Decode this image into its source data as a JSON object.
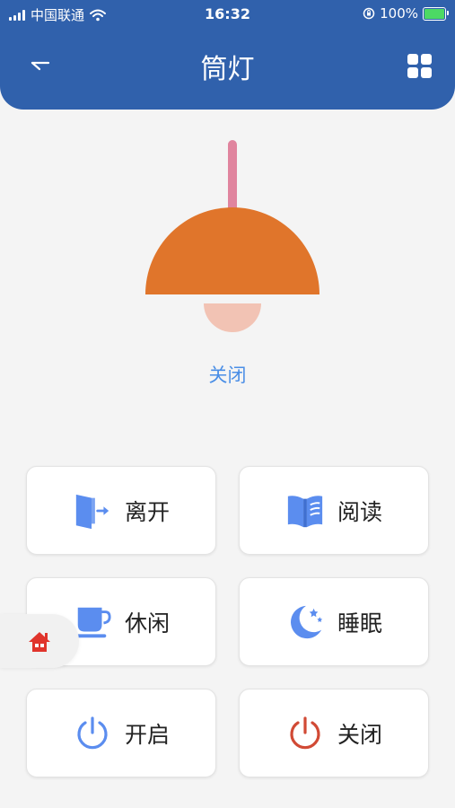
{
  "status_bar": {
    "carrier": "中国联通",
    "time": "16:32",
    "battery_percent": "100%",
    "battery_level": 1.0
  },
  "header": {
    "title": "筒灯",
    "back_icon": "back-arrow-icon",
    "menu_icon": "grid-menu-icon"
  },
  "lamp": {
    "state_label": "关闭",
    "shade_color": "#e0752b",
    "bulb_color": "#f2c3b4",
    "cord_color": "#e0849e"
  },
  "modes": [
    {
      "label": "离开",
      "icon": "exit-door-icon"
    },
    {
      "label": "阅读",
      "icon": "open-book-icon"
    },
    {
      "label": "休闲",
      "icon": "coffee-cup-icon"
    },
    {
      "label": "睡眠",
      "icon": "moon-stars-icon"
    },
    {
      "label": "开启",
      "icon": "power-on-icon"
    },
    {
      "label": "关闭",
      "icon": "power-off-icon"
    }
  ],
  "colors": {
    "header": "#3061ac",
    "accent": "#5b8def",
    "power_off": "#d14a35",
    "home": "#e0342c",
    "status_text": "#4a8ee6"
  },
  "floating_home_icon": "home-icon"
}
